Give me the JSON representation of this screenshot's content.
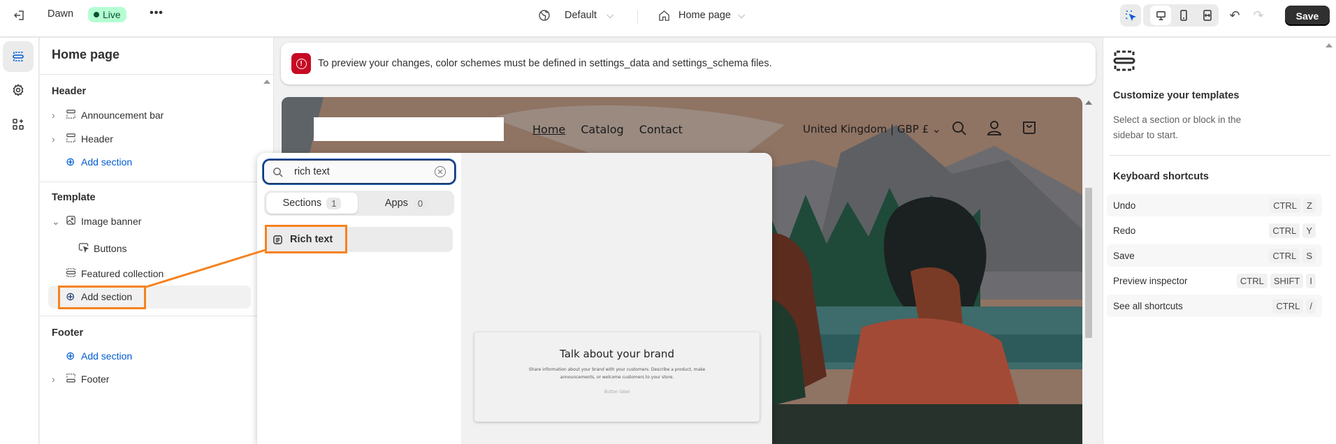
{
  "topbar": {
    "store_name": "Dawn",
    "status": "Live",
    "theme_selector": "Default",
    "page_selector": "Home page",
    "save_label": "Save"
  },
  "rail": {
    "items": [
      "sections-icon",
      "settings-icon",
      "apps-icon"
    ]
  },
  "left": {
    "title": "Home page",
    "header_group": {
      "title": "Header",
      "items": [
        "Announcement bar",
        "Header"
      ],
      "add": "Add section"
    },
    "template_group": {
      "title": "Template",
      "items": [
        "Image banner",
        "Buttons",
        "Featured collection"
      ],
      "add": "Add section"
    },
    "footer_group": {
      "title": "Footer",
      "add": "Add section",
      "items": [
        "Footer"
      ]
    }
  },
  "banner": {
    "message": "To preview your changes, color schemes must be defined in settings_data and settings_schema files."
  },
  "store": {
    "nav": [
      "Home",
      "Catalog",
      "Contact"
    ],
    "locale": "United Kingdom | GBP £"
  },
  "picker": {
    "search_value": "rich text",
    "tabs": [
      {
        "label": "Sections",
        "count": "1"
      },
      {
        "label": "Apps",
        "count": "0"
      }
    ],
    "results": [
      "Rich text"
    ],
    "preview": {
      "heading": "Talk about your brand",
      "body": "Share information about your brand with your customers. Describe a product, make announcements, or welcome customers to your store.",
      "button": "Button label"
    }
  },
  "right": {
    "title": "Customize your templates",
    "subtitle": "Select a section or block in the sidebar to start.",
    "shortcuts_title": "Keyboard shortcuts",
    "shortcuts": [
      {
        "label": "Undo",
        "keys": [
          "CTRL",
          "Z"
        ]
      },
      {
        "label": "Redo",
        "keys": [
          "CTRL",
          "Y"
        ]
      },
      {
        "label": "Save",
        "keys": [
          "CTRL",
          "S"
        ]
      },
      {
        "label": "Preview inspector",
        "keys": [
          "CTRL",
          "SHIFT",
          "I"
        ]
      },
      {
        "label": "See all shortcuts",
        "keys": [
          "CTRL",
          "/"
        ]
      }
    ]
  },
  "colors": {
    "live_badge": "#b4fed2",
    "link": "#005bd3",
    "critical": "#c70a24",
    "highlight": "#f6821f",
    "save_button": "#303030"
  }
}
